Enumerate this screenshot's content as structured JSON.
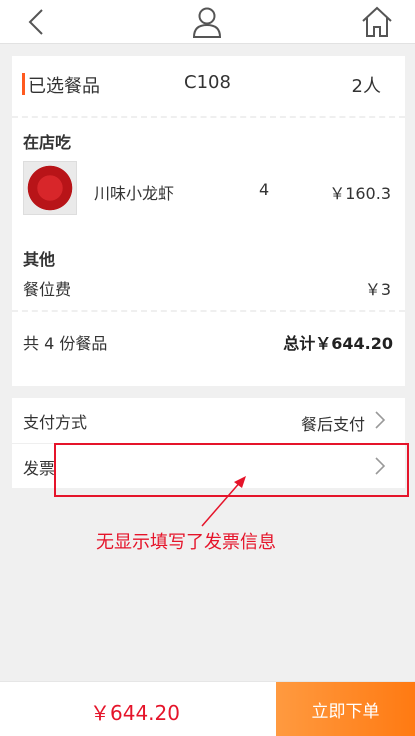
{
  "header": {
    "back_icon": "chevron-left-icon",
    "user_icon": "user-icon",
    "home_icon": "home-icon"
  },
  "order_summary": {
    "title": "已选餐品",
    "table_no": "C108",
    "people": "2人"
  },
  "dine_in": {
    "section_label": "在店吃",
    "items": [
      {
        "name": "川味小龙虾",
        "qty": "4",
        "price": "￥160.3"
      }
    ]
  },
  "other": {
    "section_label": "其他",
    "items": [
      {
        "name": "餐位费",
        "price": "￥3"
      }
    ]
  },
  "totals": {
    "count_text": "共 4 份餐品",
    "total_text": "总计￥644.20"
  },
  "options": {
    "payment_label": "支付方式",
    "payment_value": "餐后支付",
    "invoice_label": "发票"
  },
  "annotation": {
    "text": "无显示填写了发票信息",
    "color": "#e5142a"
  },
  "footer": {
    "total_price": "￥644.20",
    "order_button": "立即下单"
  },
  "colors": {
    "accent": "#ff5a1f",
    "button_gradient_start": "#ff9a40",
    "button_gradient_end": "#ff7a12",
    "price_red": "#e5142a"
  }
}
